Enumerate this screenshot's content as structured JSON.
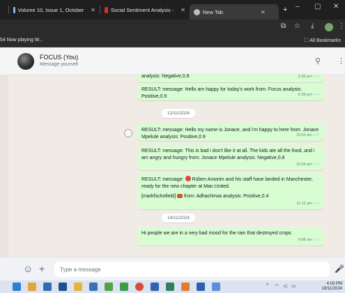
{
  "browser": {
    "tabs": [
      {
        "label": "Volume 10, Issue 1, October",
        "icon": "doc-icon"
      },
      {
        "label": "Social Sentiment Analysis -",
        "icon": "gmail-icon"
      },
      {
        "label": "New Tab",
        "icon": "chrome-icon",
        "active": true
      }
    ],
    "new_tab": "+",
    "bookmarks_left": "54 Now playing W...",
    "bookmarks_right": "All Bookmarks"
  },
  "chat": {
    "name": "FOCUS (You)",
    "subtitle": "Message yourself",
    "messages": [
      {
        "text": "analysis: Negative,0.8",
        "time": "6:36 pm"
      },
      {
        "text": "RESULT: message: Hello am happy for today's work from: Focus analysis: Positive,0.9",
        "time": "6:39 pm"
      },
      {
        "date": "12/11/2024"
      },
      {
        "text": "RESULT: message: Hello my name is Jonace, and i'm happy to here from: Jonace Mpelule analysis: Positive,0.9",
        "time": "10:53 am"
      },
      {
        "text": "RESULT: message: This is bad i don't like it at all. The kids ate all the food, and i am angry and hungry from: Jonace Mpelule analysis: Negative,0.8",
        "time": "10:54 am"
      },
      {
        "text_a": "RESULT: message:",
        "text_b": "Rúben Amorim and his staff have landed in Manchester, ready for the new chapter at Man United.",
        "text_c": "[markfschofield]",
        "text_d": "from: Adhachirwa",
        "text_e": "analysis: Positive,0.4",
        "time": "11:12 am"
      },
      {
        "date": "14/11/2024"
      },
      {
        "text": "Hi people we are in a very bad mood for the rain that destroyed crops",
        "time": "6:08 am"
      }
    ]
  },
  "composer": {
    "placeholder": "Type a message"
  },
  "taskbar": {
    "time": "4:03 PM",
    "date": "18/11/2024"
  }
}
